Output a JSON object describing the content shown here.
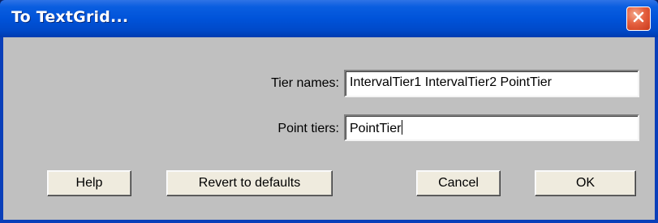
{
  "window": {
    "title": "To TextGrid...",
    "close_icon": "close-x-icon"
  },
  "form": {
    "tier_names": {
      "label": "Tier names:",
      "value": "IntervalTier1 IntervalTier2 PointTier"
    },
    "point_tiers": {
      "label": "Point tiers:",
      "value": "PointTier"
    }
  },
  "buttons": {
    "help": "Help",
    "revert": "Revert to defaults",
    "cancel": "Cancel",
    "ok": "OK"
  },
  "colors": {
    "titlebar": "#0053d9",
    "client_background": "#c0c0c0",
    "close_button": "#e5603f"
  }
}
